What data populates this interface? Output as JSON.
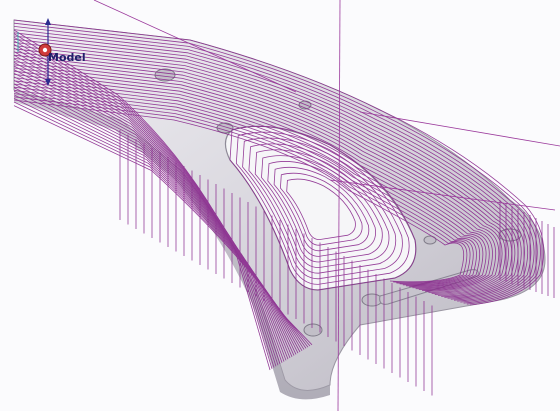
{
  "viewport": {
    "triad_label": "Model",
    "background": "#fbfbfd",
    "toolpath_color": "#8a2a8e",
    "part_color": "#d8d6dc",
    "part_edge_color": "#9e9aa6"
  }
}
